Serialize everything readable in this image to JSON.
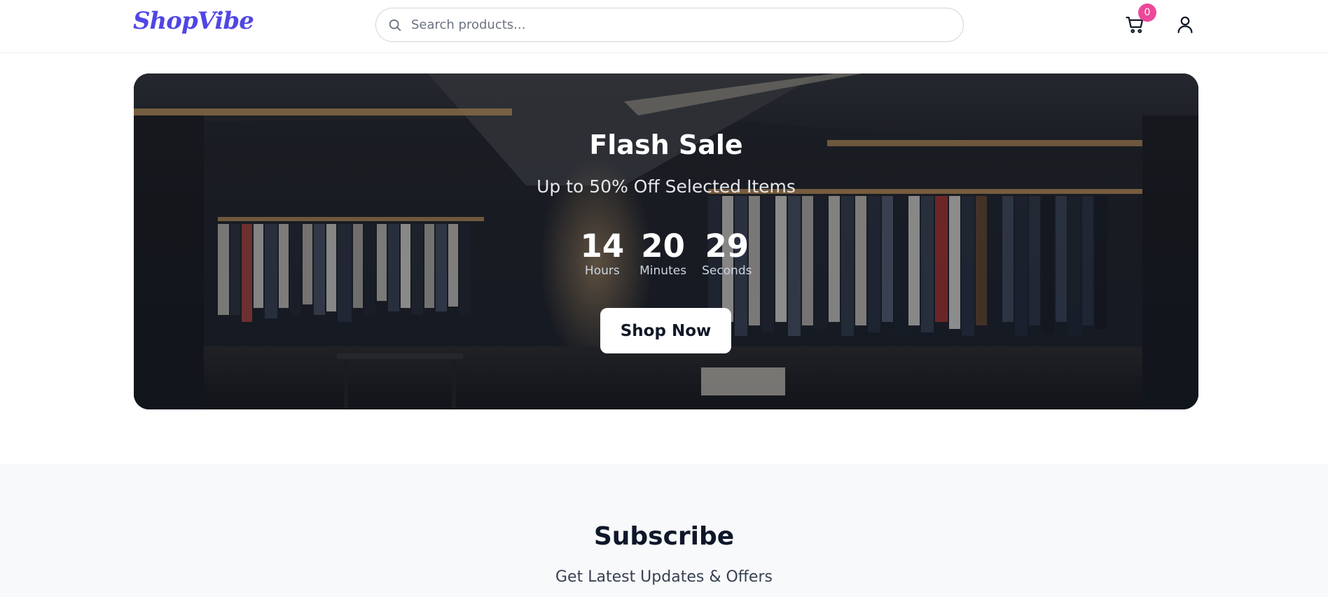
{
  "header": {
    "logo": "ShopVibe",
    "search": {
      "placeholder": "Search products..."
    },
    "cart": {
      "icon": "cart-icon",
      "count": "0",
      "badge_color": "#ec4899"
    },
    "user": {
      "icon": "user-icon"
    }
  },
  "hero": {
    "title": "Flash Sale",
    "subtitle": "Up to 50% Off Selected Items",
    "countdown": [
      {
        "value": "14",
        "label": "Hours"
      },
      {
        "value": "20",
        "label": "Minutes"
      },
      {
        "value": "29",
        "label": "Seconds"
      }
    ],
    "cta": "Shop Now"
  },
  "subscribe": {
    "title": "Subscribe",
    "text": "Get Latest Updates & Offers"
  },
  "colors": {
    "brand": "#4f46e5",
    "badge": "#ec4899",
    "dark_text": "#0f172a"
  }
}
